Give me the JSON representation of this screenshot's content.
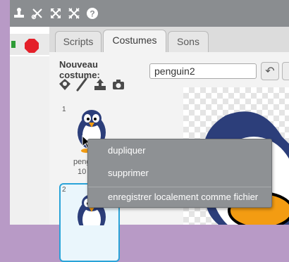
{
  "tabs": [
    "Scripts",
    "Costumes",
    "Sons"
  ],
  "costume_panel": {
    "new_costume_label": "Nouveau costume:",
    "costumes": [
      {
        "number": "1",
        "name": "peng",
        "size": "10"
      },
      {
        "number": "2"
      }
    ]
  },
  "editor": {
    "costume_name_value": "penguin2"
  },
  "context_menu": {
    "items": [
      "dupliquer",
      "supprimer",
      "enregistrer localement comme fichier"
    ]
  },
  "colors": {
    "accent": "#2aa3d8",
    "stop": "#e4202a",
    "flag": "#2f9c37"
  },
  "icons": [
    "stamp-icon",
    "scissors-icon",
    "grow-icon",
    "shrink-icon",
    "help-icon",
    "paint-costume-icon",
    "brush-icon",
    "import-icon",
    "camera-icon",
    "undo-icon"
  ]
}
